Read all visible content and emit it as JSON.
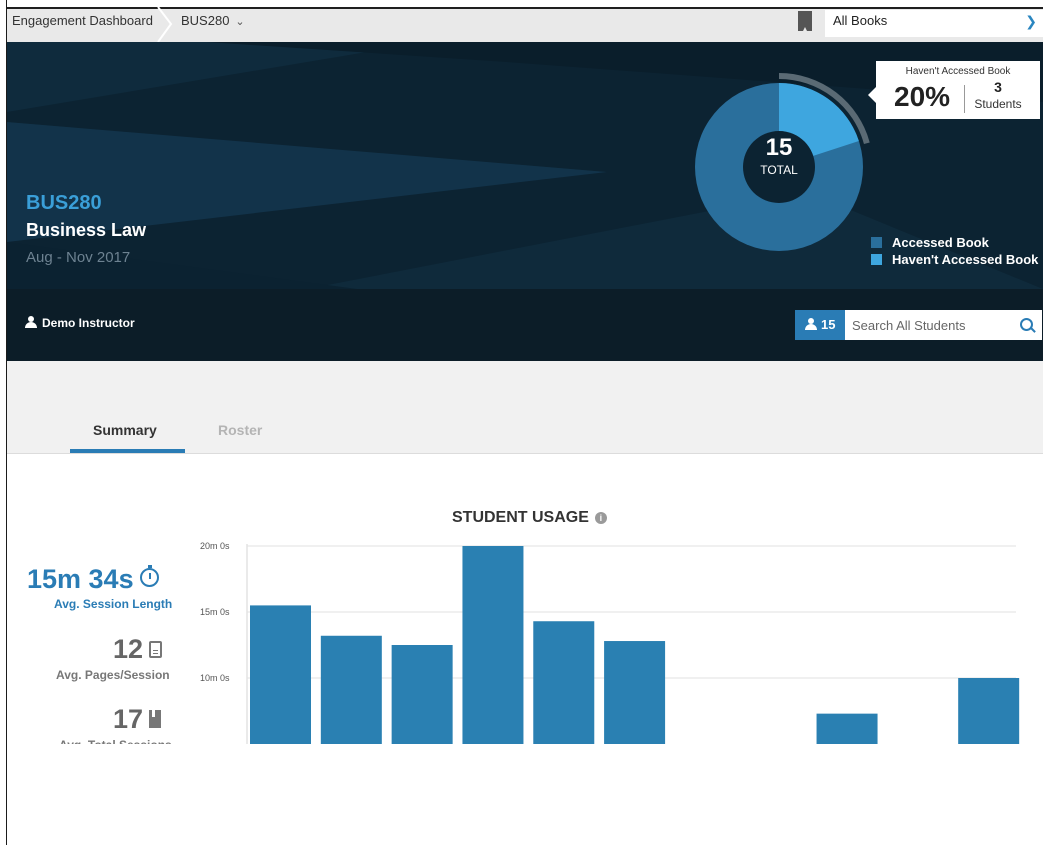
{
  "topbar": {
    "home_label": "Engagement Dashboard",
    "course_label": "BUS280",
    "books_select_value": "All Books"
  },
  "hero": {
    "course_code": "BUS280",
    "course_name": "Business Law",
    "term": "Aug - Nov 2017",
    "donut": {
      "total": "15",
      "total_label": "TOTAL",
      "accessed": 12,
      "not_accessed": 3,
      "accessed_color": "#2a6f9c",
      "not_accessed_color": "#3ea6df"
    },
    "tooltip": {
      "title": "Haven't Accessed Book",
      "percent": "20%",
      "count": "3",
      "unit": "Students"
    },
    "legend": [
      {
        "label": "Accessed Book",
        "color": "#2a6f9c"
      },
      {
        "label": "Haven't Accessed Book",
        "color": "#3ea6df"
      }
    ]
  },
  "instructor_bar": {
    "instructor_name": "Demo Instructor",
    "student_count": "15",
    "search_placeholder": "Search All Students"
  },
  "tabs": [
    {
      "label": "Summary",
      "active": true
    },
    {
      "label": "Roster",
      "active": false
    }
  ],
  "stats": [
    {
      "value": "15m 34s",
      "label": "Avg. Session Length",
      "icon": "stopwatch-icon"
    },
    {
      "value": "12",
      "label": "Avg. Pages/Session",
      "icon": "page-icon"
    },
    {
      "value": "17",
      "label": "Avg. Total Sessions",
      "icon": "bookmark-icon"
    }
  ],
  "chart_data": {
    "type": "bar",
    "title": "STUDENT USAGE",
    "ylabel": "",
    "xlabel": "",
    "y_unit": "minutes",
    "ytick_labels": [
      "10m 0s",
      "15m 0s",
      "20m 0s"
    ],
    "ytick_values": [
      10,
      15,
      20
    ],
    "ylim_visible": [
      5,
      20
    ],
    "values": [
      15.5,
      13.2,
      12.5,
      20.0,
      14.3,
      12.8,
      0,
      0,
      7.3,
      0,
      10.0
    ],
    "bar_color": "#2a80b2",
    "grid": true
  }
}
